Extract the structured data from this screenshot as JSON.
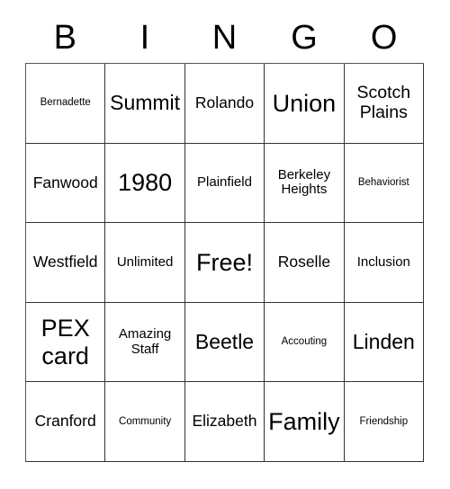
{
  "card": {
    "header_letters": [
      "B",
      "I",
      "N",
      "G",
      "O"
    ],
    "colors": {
      "background": "#ffffff",
      "text": "#000000",
      "grid_line": "#333333"
    },
    "rows": [
      [
        {
          "text": "Bernadette",
          "size": "fs-xs"
        },
        {
          "text": "Summit",
          "size": "fs-xl"
        },
        {
          "text": "Rolando",
          "size": "fs-md"
        },
        {
          "text": "Union",
          "size": "fs-xxl"
        },
        {
          "text": "Scotch Plains",
          "size": "fs-lg"
        }
      ],
      [
        {
          "text": "Fanwood",
          "size": "fs-md"
        },
        {
          "text": "1980",
          "size": "fs-xxl"
        },
        {
          "text": "Plainfield",
          "size": "fs-sm"
        },
        {
          "text": "Berkeley Heights",
          "size": "fs-sm"
        },
        {
          "text": "Behaviorist",
          "size": "fs-xs"
        }
      ],
      [
        {
          "text": "Westfield",
          "size": "fs-md"
        },
        {
          "text": "Unlimited",
          "size": "fs-sm"
        },
        {
          "text": "Free!",
          "size": "fs-xxl"
        },
        {
          "text": "Roselle",
          "size": "fs-md"
        },
        {
          "text": "Inclusion",
          "size": "fs-sm"
        }
      ],
      [
        {
          "text": "PEX card",
          "size": "fs-xxl"
        },
        {
          "text": "Amazing Staff",
          "size": "fs-sm"
        },
        {
          "text": "Beetle",
          "size": "fs-xl"
        },
        {
          "text": "Accouting",
          "size": "fs-xs"
        },
        {
          "text": "Linden",
          "size": "fs-xl"
        }
      ],
      [
        {
          "text": "Cranford",
          "size": "fs-md"
        },
        {
          "text": "Community",
          "size": "fs-xs"
        },
        {
          "text": "Elizabeth",
          "size": "fs-md"
        },
        {
          "text": "Family",
          "size": "fs-xxl"
        },
        {
          "text": "Friendship",
          "size": "fs-xs"
        }
      ]
    ]
  }
}
